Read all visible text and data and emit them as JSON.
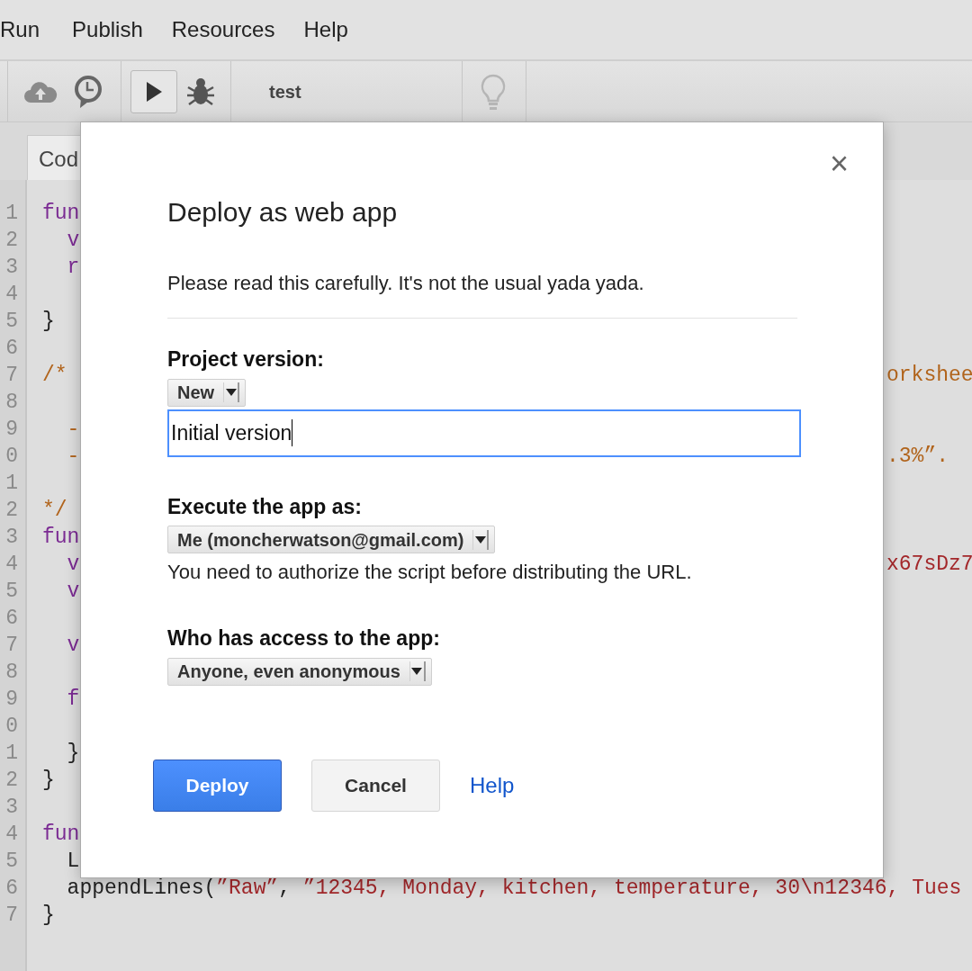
{
  "menu": [
    {
      "label": "Run"
    },
    {
      "label": "Publish"
    },
    {
      "label": "Resources"
    },
    {
      "label": "Help"
    }
  ],
  "toolbar": {
    "file_name": "test"
  },
  "editor": {
    "tab": {
      "label": "Cod"
    },
    "lines": [
      {
        "number": "1",
        "left": [
          {
            "text": "fun",
            "kind": "keyword"
          }
        ]
      },
      {
        "number": "2",
        "left": [
          {
            "text": "  v",
            "kind": "keyword"
          }
        ]
      },
      {
        "number": "3",
        "left": [
          {
            "text": "  r",
            "kind": "keyword"
          }
        ]
      },
      {
        "number": "4"
      },
      {
        "number": "5",
        "left": [
          {
            "text": "}",
            "kind": "plain"
          }
        ]
      },
      {
        "number": "6"
      },
      {
        "number": "7",
        "left": [
          {
            "text": "/*",
            "kind": "comment"
          }
        ],
        "right": {
          "text": "orkshee",
          "kind": "comment"
        }
      },
      {
        "number": "8"
      },
      {
        "number": "9",
        "left": [
          {
            "text": "  -",
            "kind": "comment"
          }
        ]
      },
      {
        "number": "0",
        "left": [
          {
            "text": "  -",
            "kind": "comment"
          }
        ],
        "right": {
          "text": ".3%”.",
          "kind": "comment"
        }
      },
      {
        "number": "1"
      },
      {
        "number": "2",
        "left": [
          {
            "text": "*/",
            "kind": "comment"
          }
        ]
      },
      {
        "number": "3",
        "left": [
          {
            "text": "fun",
            "kind": "keyword"
          }
        ]
      },
      {
        "number": "4",
        "left": [
          {
            "text": "  v",
            "kind": "keyword"
          }
        ],
        "right": {
          "text": "x67sDz7",
          "kind": "string"
        }
      },
      {
        "number": "5",
        "left": [
          {
            "text": "  v",
            "kind": "keyword"
          }
        ]
      },
      {
        "number": "6"
      },
      {
        "number": "7",
        "left": [
          {
            "text": "  v",
            "kind": "keyword"
          }
        ]
      },
      {
        "number": "8"
      },
      {
        "number": "9",
        "left": [
          {
            "text": "  f",
            "kind": "keyword"
          }
        ]
      },
      {
        "number": "0"
      },
      {
        "number": "1",
        "left": [
          {
            "text": "  }",
            "kind": "plain"
          }
        ]
      },
      {
        "number": "2",
        "left": [
          {
            "text": "}",
            "kind": "plain"
          }
        ]
      },
      {
        "number": "3"
      },
      {
        "number": "4",
        "left": [
          {
            "text": "fun",
            "kind": "keyword"
          }
        ]
      },
      {
        "number": "5",
        "left": [
          {
            "text": "  L",
            "kind": "plain"
          }
        ]
      },
      {
        "number": "6",
        "left": [
          {
            "text": "  appendLines(",
            "kind": "plain"
          },
          {
            "text": "”Raw”",
            "kind": "string"
          },
          {
            "text": ", ",
            "kind": "plain"
          },
          {
            "text": "”12345, Monday, kitchen, temperature, 30\\n12346, Tues",
            "kind": "string"
          }
        ]
      },
      {
        "number": "7",
        "left": [
          {
            "text": "}",
            "kind": "plain"
          }
        ]
      }
    ]
  },
  "dialog": {
    "close": "×",
    "title": "Deploy as web app",
    "intro": "Please read this carefully. It's not the usual yada yada.",
    "sections": [
      {
        "label": "Project version:",
        "select": "New",
        "input": {
          "value": "Initial version",
          "focused": true
        }
      },
      {
        "label": "Execute the app as:",
        "select": "Me (moncherwatson@gmail.com)",
        "note": "You need to authorize the script before distributing the URL."
      },
      {
        "label": "Who has access to the app:",
        "select": "Anyone, even anonymous"
      }
    ],
    "buttons": [
      {
        "label": "Deploy",
        "kind": "primary"
      },
      {
        "label": "Cancel",
        "kind": "secondary"
      },
      {
        "label": "Help",
        "kind": "link"
      }
    ]
  }
}
